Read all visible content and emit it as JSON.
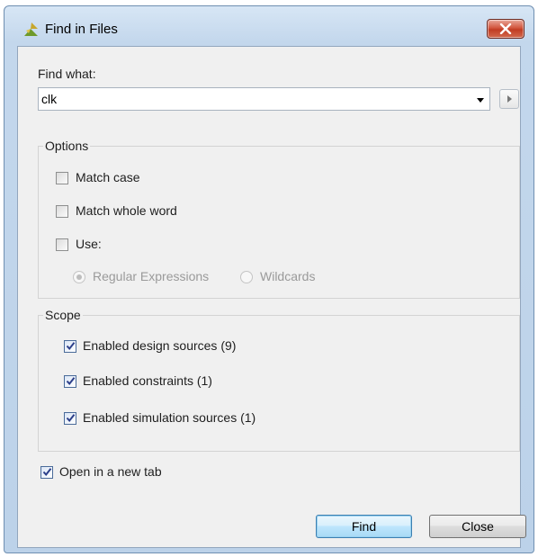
{
  "window": {
    "title": "Find in Files"
  },
  "find": {
    "label": "Find what:",
    "value": "clk"
  },
  "options": {
    "title": "Options",
    "match_case": {
      "label": "Match case",
      "checked": false
    },
    "whole_word": {
      "label": "Match whole word",
      "checked": false
    },
    "use": {
      "label": "Use:",
      "checked": false
    },
    "regex": {
      "label": "Regular Expressions",
      "selected": true,
      "enabled": false
    },
    "wildcards": {
      "label": "Wildcards",
      "selected": false,
      "enabled": false
    }
  },
  "scope": {
    "title": "Scope",
    "items": [
      {
        "label": "Enabled design sources (9)",
        "checked": true
      },
      {
        "label": "Enabled constraints (1)",
        "checked": true
      },
      {
        "label": "Enabled simulation sources (1)",
        "checked": true
      }
    ]
  },
  "open_new_tab": {
    "label": "Open in a new tab",
    "checked": true
  },
  "buttons": {
    "find": "Find",
    "close": "Close"
  },
  "icons": {
    "app": "vivado-leaf-icon",
    "close": "close-x-icon",
    "dropdown": "chevron-down-icon",
    "next": "play-arrow-icon"
  }
}
